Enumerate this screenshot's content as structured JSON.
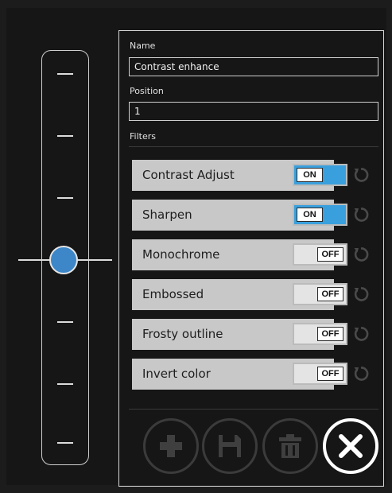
{
  "slider": {
    "value_fraction": 0.5
  },
  "form": {
    "name_label": "Name",
    "name_value": "Contrast enhance",
    "position_label": "Position",
    "position_value": "1",
    "filters_label": "Filters"
  },
  "filters": [
    {
      "label": "Contrast Adjust",
      "state": "ON"
    },
    {
      "label": "Sharpen",
      "state": "ON"
    },
    {
      "label": "Monochrome",
      "state": "OFF"
    },
    {
      "label": "Embossed",
      "state": "OFF"
    },
    {
      "label": "Frosty outline",
      "state": "OFF"
    },
    {
      "label": "Invert color",
      "state": "OFF"
    }
  ],
  "actions": [
    {
      "name": "add",
      "icon": "plus-icon",
      "enabled": false
    },
    {
      "name": "save",
      "icon": "floppy-disk-icon",
      "enabled": false
    },
    {
      "name": "delete",
      "icon": "trash-icon",
      "enabled": false
    },
    {
      "name": "close",
      "icon": "close-icon",
      "enabled": true
    }
  ],
  "colors": {
    "accent": "#3d86c8",
    "toggle_on": "#3aa0dd",
    "row_bg": "#c8c8c8"
  }
}
